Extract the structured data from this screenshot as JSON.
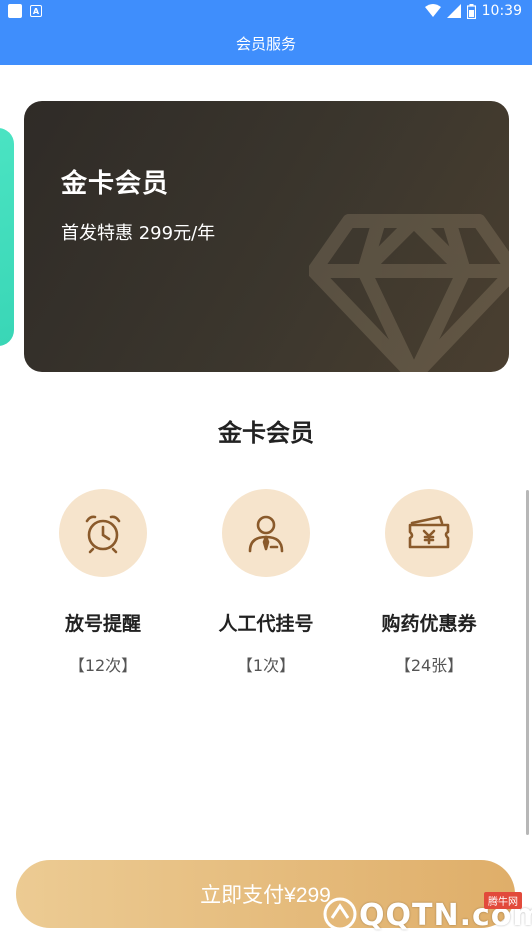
{
  "status_bar": {
    "time": "10:39",
    "icon_a": "A"
  },
  "header": {
    "title": "会员服务"
  },
  "card": {
    "title": "金卡会员",
    "subtitle": "首发特惠 299元/年",
    "accent_colors": [
      "#2f2b27",
      "#4a3f30"
    ]
  },
  "section": {
    "title": "金卡会员"
  },
  "benefits": [
    {
      "icon": "alarm-clock-icon",
      "label": "放号提醒",
      "count": "【12次】"
    },
    {
      "icon": "agent-person-icon",
      "label": "人工代挂号",
      "count": "【1次】"
    },
    {
      "icon": "coupon-wallet-icon",
      "label": "购药优惠券",
      "count": "【24张】"
    }
  ],
  "pay_button": {
    "label": "立即支付¥299"
  },
  "watermark": {
    "text": "QQTN.com",
    "tag": "腾牛网"
  },
  "colors": {
    "primary_blue": "#3f8efc",
    "gold": "#dfae69",
    "benefit_bg": "#f6e4cc",
    "icon_brown": "#8a5a2b"
  }
}
